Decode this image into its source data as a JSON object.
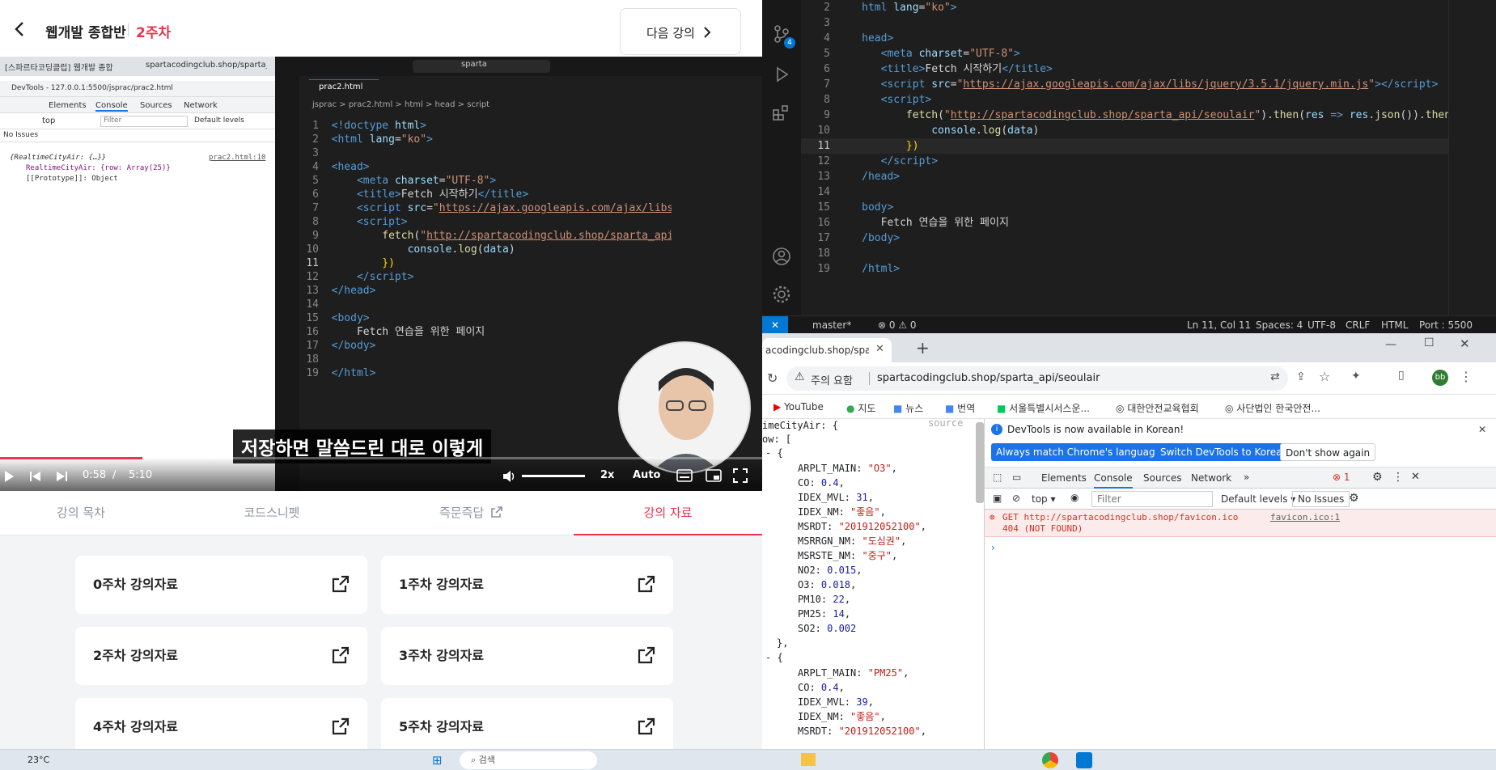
{
  "course": {
    "title": "웹개발 종합반",
    "week": "2주차",
    "next_label": "다음 강의"
  },
  "inner_browser": {
    "tab1": "[스파르타코딩클럽] 웹개발 종합",
    "tab2": "spartacodingclub.shop/sparta_a",
    "devtools_title": "DevTools - 127.0.0.1:5500/jsprac/prac2.html",
    "tabs": [
      "Elements",
      "Console",
      "Sources",
      "Network"
    ],
    "context": "top",
    "filter_placeholder": "Filter",
    "levels": "Default levels",
    "no_issues": "No Issues",
    "log_obj": "{RealtimeCityAir: {…}}",
    "log_src": "prac2.html:10",
    "log_prop": "RealtimeCityAir: {row: Array(25)}",
    "log_proto": "[[Prototype]]: Object"
  },
  "inner_vscode": {
    "search": "sparta",
    "file_tab": "prac2.html",
    "breadcrumb": [
      "jsprac",
      "prac2.html",
      "html",
      "head",
      "script"
    ]
  },
  "video": {
    "subtitle": "저장하면 말씀드린 대로 이렇게",
    "time_current": "0:58",
    "time_total": "5:10",
    "speed": "2x",
    "quality": "Auto",
    "progress": 0.187
  },
  "lecture_tabs": [
    "강의 목차",
    "코드스니펫",
    "즉문즉답",
    "강의 자료"
  ],
  "materials": [
    "0주차 강의자료",
    "1주차 강의자료",
    "2주차 강의자료",
    "3주차 강의자료",
    "4주차 강의자료",
    "5주차 강의자료"
  ],
  "editor_right": {
    "status": {
      "branch": "master*",
      "problems": "0 ⚠ 0",
      "cursor": "Ln 11, Col 11",
      "spaces": "Spaces: 4",
      "encoding": "UTF-8",
      "eol": "CRLF",
      "lang": "HTML",
      "port": "Port : 5500"
    },
    "ext_badge": "4"
  },
  "chrome": {
    "tab_title": "acodingclub.shop/sparta_a",
    "address_warning": "주의 요함",
    "address": "spartacodingclub.shop/sparta_api/seoulair",
    "bookmarks": [
      "YouTube",
      "지도",
      "뉴스",
      "번역",
      "서울특별시서스운...",
      "대한안전교육협회",
      "사단법인 한국안전..."
    ],
    "avatar": "bb",
    "view_source": "view source",
    "infobar": "DevTools is now available in Korean!",
    "btn_match": "Always match Chrome's language",
    "btn_switch": "Switch DevTools to Korean",
    "btn_dont": "Don't show again",
    "dt_tabs": [
      "Elements",
      "Console",
      "Sources",
      "Network"
    ],
    "error_count": "1",
    "context": "top",
    "filter": "Filter",
    "levels": "Default levels",
    "no_issues": "No Issues",
    "error_text": "GET http://spartacodingclub.shop/favicon.ico 404 (NOT FOUND)",
    "error_src": "favicon.ico:1"
  },
  "taskbar": {
    "temp": "23°C",
    "search": "검색"
  }
}
